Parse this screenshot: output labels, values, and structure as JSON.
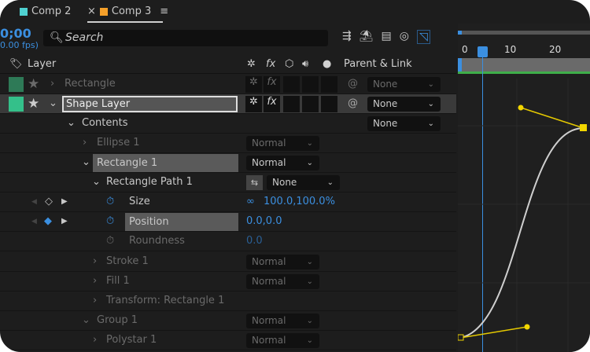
{
  "tabs": [
    {
      "label": "Comp 2",
      "color": "#4fd1d1"
    },
    {
      "label": "Comp 3",
      "color": "#f5a02a",
      "active": true
    }
  ],
  "timecode": "0;00",
  "fps": "0.00 fps)",
  "search": {
    "placeholder": "Search"
  },
  "header": {
    "layer": "Layer",
    "parent": "Parent & Link"
  },
  "layers": [
    {
      "name": "Rectangle",
      "color": "#2e7a57",
      "parent": "None"
    },
    {
      "name": "Shape Layer",
      "color": "#34c08a",
      "parent": "None"
    }
  ],
  "contents": {
    "label": "Contents",
    "blend": "None"
  },
  "props": {
    "ellipse": "Ellipse 1",
    "rect": "Rectangle 1",
    "rectpath": "Rectangle Path 1",
    "size": "Size",
    "size_val": "100.0,100.0%",
    "position": "Position",
    "position_val": "0.0,0.0",
    "roundness": "Roundness",
    "roundness_val": "0.0",
    "stroke": "Stroke 1",
    "fill": "Fill 1",
    "transform": "Transform: Rectangle 1",
    "group": "Group 1",
    "polystar": "Polystar 1",
    "normal": "Normal",
    "none": "None"
  },
  "ruler": {
    "ticks": [
      "0",
      "10",
      "20"
    ]
  },
  "accent": "#3b8fe0"
}
